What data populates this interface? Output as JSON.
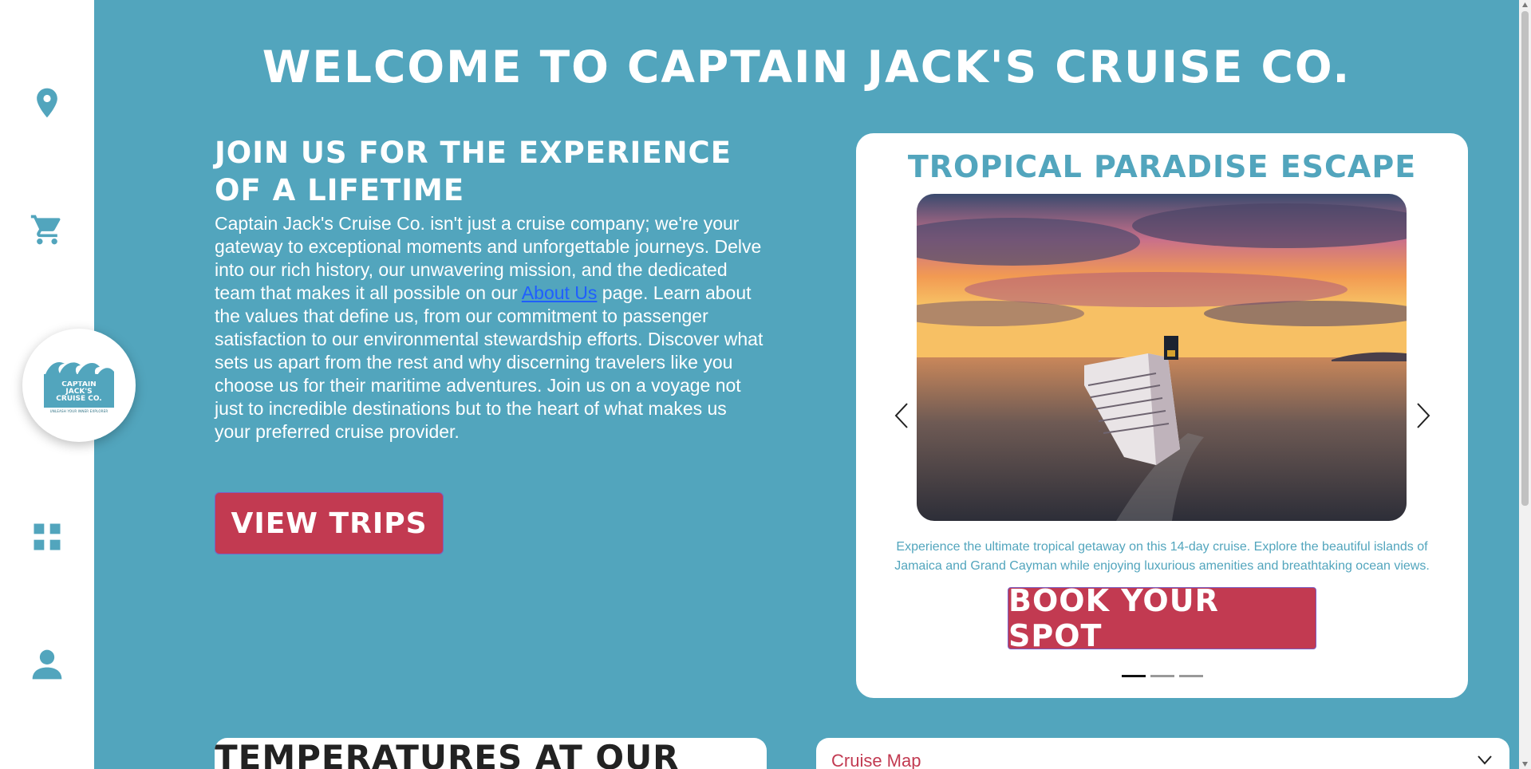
{
  "header": {
    "title": "Welcome to Captain Jack's Cruise Co."
  },
  "sidebar": {
    "items": [
      {
        "icon": "location-pin-icon"
      },
      {
        "icon": "shopping-cart-icon"
      },
      {
        "icon": "grid-apps-icon"
      },
      {
        "icon": "user-profile-icon"
      }
    ],
    "logo": {
      "line1": "CAPTAIN",
      "line2": "JACK'S",
      "line3": "CRUISE CO.",
      "tagline": "UNLEASH YOUR INNER EXPLORER"
    }
  },
  "intro": {
    "heading": "Join us for the experience of a lifetime",
    "text_before_link": "Captain Jack's Cruise Co. isn't just a cruise company; we're your gateway to exceptional moments and unforgettable journeys. Delve into our rich history, our unwavering mission, and the dedicated team that makes it all possible on our ",
    "link_text": "About Us",
    "text_after_link": " page. Learn about the values that define us, from our commitment to passenger satisfaction to our environmental stewardship efforts. Discover what sets us apart from the rest and why discerning travelers like you choose us for their maritime adventures. Join us on a voyage not just to incredible destinations but to the heart of what makes us your preferred cruise provider.",
    "button_label": "View Trips"
  },
  "carousel": {
    "title": "Tropical Paradise Escape",
    "description": "Experience the ultimate tropical getaway on this 14-day cruise. Explore the beautiful islands of Jamaica and Grand Cayman while enjoying luxurious amenities and breathtaking ocean views.",
    "button_label": "Book Your Spot",
    "slide_count": 3,
    "active_slide": 1
  },
  "sections": {
    "temperatures_title": "Temperatures at our",
    "map_label": "Cruise Map"
  },
  "colors": {
    "background": "#52a5bd",
    "accent": "#c23a51",
    "link": "#1f5fff",
    "white": "#ffffff"
  }
}
